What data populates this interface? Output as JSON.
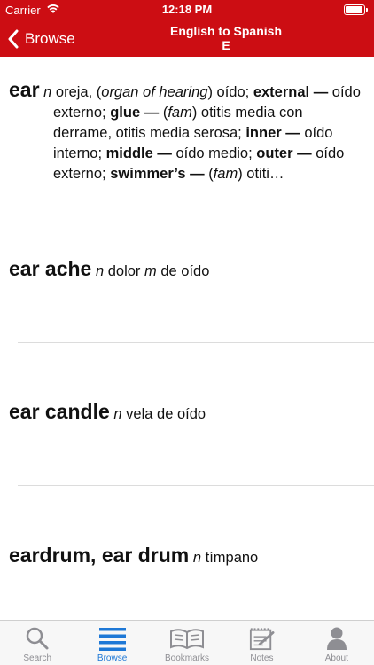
{
  "status": {
    "carrier": "Carrier",
    "time": "12:18 PM"
  },
  "nav": {
    "back_label": "Browse",
    "title_line1": "English to Spanish",
    "title_line2": "E"
  },
  "tabs": [
    {
      "label": "Search",
      "icon": "search-icon"
    },
    {
      "label": "Browse",
      "icon": "browse-list-icon",
      "active": true
    },
    {
      "label": "Bookmarks",
      "icon": "book-icon"
    },
    {
      "label": "Notes",
      "icon": "notepad-icon"
    },
    {
      "label": "About",
      "icon": "person-icon"
    }
  ],
  "colors": {
    "header": "#cc0d13",
    "active_tab": "#1e78d6",
    "inactive_tab": "#8e8e93"
  },
  "entries": [
    {
      "headword": "ear",
      "segments": [
        {
          "t": " "
        },
        {
          "i": "n"
        },
        {
          "t": " oreja, ("
        },
        {
          "i": "organ of hearing"
        },
        {
          "t": ") oído; "
        },
        {
          "b": "external —"
        },
        {
          "t": " oído externo; "
        },
        {
          "b": "glue —"
        },
        {
          "t": " ("
        },
        {
          "i": "fam"
        },
        {
          "t": ") otitis media con derrame, otitis media serosa; "
        },
        {
          "b": "inner —"
        },
        {
          "t": " oído interno; "
        },
        {
          "b": "middle —"
        },
        {
          "t": " oído medio; "
        },
        {
          "b": "outer"
        },
        {
          "b": " —"
        },
        {
          "t": " oído externo; "
        },
        {
          "b": "swimmer’s —"
        },
        {
          "t": " ("
        },
        {
          "i": "fam"
        },
        {
          "t": ") otiti…"
        }
      ]
    },
    {
      "headword": "ear ache",
      "segments": [
        {
          "t": " "
        },
        {
          "i": "n"
        },
        {
          "t": " dolor "
        },
        {
          "i": "m"
        },
        {
          "t": " de oído"
        }
      ]
    },
    {
      "headword": "ear candle",
      "segments": [
        {
          "t": " "
        },
        {
          "i": "n"
        },
        {
          "t": " vela de oído"
        }
      ]
    },
    {
      "headword": "eardrum, ear drum",
      "segments": [
        {
          "t": " "
        },
        {
          "i": "n"
        },
        {
          "t": " tímpano"
        }
      ]
    }
  ]
}
